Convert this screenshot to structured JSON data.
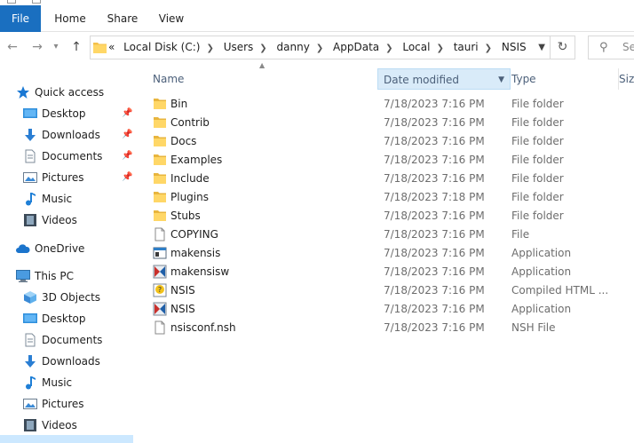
{
  "ribbon": {
    "tabs": [
      "File",
      "Home",
      "Share",
      "View"
    ]
  },
  "nav": {
    "back": "←",
    "forward": "→",
    "history": "▾",
    "up": "↑",
    "refresh": "↻",
    "search_placeholder": "Se"
  },
  "address": {
    "overflow": "«",
    "crumbs": [
      "Local Disk (C:)",
      "Users",
      "danny",
      "AppData",
      "Local",
      "tauri",
      "NSIS"
    ]
  },
  "sidebar": {
    "quick_access": "Quick access",
    "quick_items": [
      {
        "label": "Desktop",
        "icon": "desktop-icon",
        "pinned": true
      },
      {
        "label": "Downloads",
        "icon": "download-icon",
        "pinned": true
      },
      {
        "label": "Documents",
        "icon": "documents-icon",
        "pinned": true
      },
      {
        "label": "Pictures",
        "icon": "pictures-icon",
        "pinned": true
      },
      {
        "label": "Music",
        "icon": "music-icon",
        "pinned": false
      },
      {
        "label": "Videos",
        "icon": "videos-icon",
        "pinned": false
      }
    ],
    "onedrive": "OneDrive",
    "this_pc": "This PC",
    "pc_items": [
      {
        "label": "3D Objects",
        "icon": "cube-icon"
      },
      {
        "label": "Desktop",
        "icon": "desktop-icon"
      },
      {
        "label": "Documents",
        "icon": "documents-icon"
      },
      {
        "label": "Downloads",
        "icon": "download-icon"
      },
      {
        "label": "Music",
        "icon": "music-icon"
      },
      {
        "label": "Pictures",
        "icon": "pictures-icon"
      },
      {
        "label": "Videos",
        "icon": "videos-icon"
      }
    ]
  },
  "columns": {
    "name": "Name",
    "date": "Date modified",
    "type": "Type",
    "size": "Size"
  },
  "files": [
    {
      "name": "Bin",
      "date": "7/18/2023 7:16 PM",
      "type": "File folder",
      "icon": "folder-icon"
    },
    {
      "name": "Contrib",
      "date": "7/18/2023 7:16 PM",
      "type": "File folder",
      "icon": "folder-icon"
    },
    {
      "name": "Docs",
      "date": "7/18/2023 7:16 PM",
      "type": "File folder",
      "icon": "folder-icon"
    },
    {
      "name": "Examples",
      "date": "7/18/2023 7:16 PM",
      "type": "File folder",
      "icon": "folder-icon"
    },
    {
      "name": "Include",
      "date": "7/18/2023 7:16 PM",
      "type": "File folder",
      "icon": "folder-icon"
    },
    {
      "name": "Plugins",
      "date": "7/18/2023 7:18 PM",
      "type": "File folder",
      "icon": "folder-icon"
    },
    {
      "name": "Stubs",
      "date": "7/18/2023 7:16 PM",
      "type": "File folder",
      "icon": "folder-icon"
    },
    {
      "name": "COPYING",
      "date": "7/18/2023 7:16 PM",
      "type": "File",
      "icon": "file-icon"
    },
    {
      "name": "makensis",
      "date": "7/18/2023 7:16 PM",
      "type": "Application",
      "icon": "app-window-icon"
    },
    {
      "name": "makensisw",
      "date": "7/18/2023 7:16 PM",
      "type": "Application",
      "icon": "nsis-app-icon"
    },
    {
      "name": "NSIS",
      "date": "7/18/2023 7:16 PM",
      "type": "Compiled HTML ...",
      "icon": "chm-help-icon"
    },
    {
      "name": "NSIS",
      "date": "7/18/2023 7:16 PM",
      "type": "Application",
      "icon": "nsis-app-icon"
    },
    {
      "name": "nsisconf.nsh",
      "date": "7/18/2023 7:16 PM",
      "type": "NSH File",
      "icon": "file-icon"
    }
  ]
}
